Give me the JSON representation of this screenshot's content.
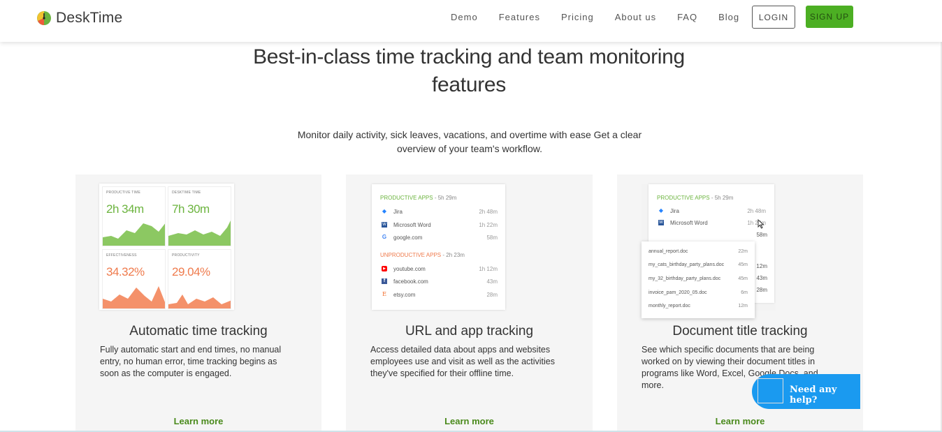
{
  "header": {
    "logo_text": "DeskTime",
    "nav": [
      "Demo",
      "Features",
      "Pricing",
      "About us",
      "FAQ",
      "Blog"
    ],
    "login_label": "LOGIN",
    "signup_label": "SIGN UP",
    "colors": {
      "signup_bg": "#4caf23"
    }
  },
  "hero": {
    "title_line1": "Best-in-class time tracking and team monitoring",
    "title_line2": "features",
    "subtitle_line1": "Monitor daily activity, sick leaves, vacations, and overtime with ease Get a clear",
    "subtitle_line2": "overview of your team's workflow."
  },
  "cards": [
    {
      "title": "Automatic time tracking",
      "desc_lines": [
        "Fully automatic start and end times, no manual",
        "entry, no human error, time tracking begins as",
        "soon as the computer is engaged."
      ],
      "link": "Learn more",
      "tiles": [
        {
          "label": "PRODUCTIVE TIME",
          "value": "2h 34m"
        },
        {
          "label": "DESKTIME TIME",
          "value": "7h 30m"
        },
        {
          "label": "EFFECTIVENESS",
          "value": "34.32%"
        },
        {
          "label": "PRODUCTIVITY",
          "value": "29.04%"
        }
      ]
    },
    {
      "title": "URL and app tracking",
      "desc_lines": [
        "Access detailed data about apps and websites",
        "employees use and visit as well as the activities",
        "they've specified for their offline time."
      ],
      "link": "Learn more",
      "productive": {
        "label": "PRODUCTIVE APPS",
        "duration": "- 5h 29m",
        "apps": [
          {
            "name": "Jira",
            "time": "2h 48m"
          },
          {
            "name": "Microsoft Word",
            "time": "1h 22m"
          },
          {
            "name": "google.com",
            "time": "58m"
          }
        ]
      },
      "unproductive": {
        "label": "UNPRODUCTIVE APPS",
        "duration": "- 2h 23m",
        "apps": [
          {
            "name": "youtube.com",
            "time": "1h 12m"
          },
          {
            "name": "facebook.com",
            "time": "43m"
          },
          {
            "name": "etsy.com",
            "time": "28m"
          }
        ]
      }
    },
    {
      "title": "Document title tracking",
      "desc_lines": [
        "See which specific documents that are being",
        "worked on by viewing their document titles in",
        "programs like Word, Excel, Google Docs, and",
        "more."
      ],
      "link": "Learn more",
      "productive": {
        "label": "PRODUCTIVE APPS",
        "duration": "- 5h 29m",
        "apps": [
          {
            "name": "Jira",
            "time": "2h 48m"
          },
          {
            "name": "Microsoft Word",
            "time": "1h 22m"
          }
        ],
        "hidden_times": [
          "58m",
          "1h 12m",
          "43m",
          "28m"
        ]
      },
      "docs": [
        {
          "name": "annual_report.doc",
          "time": "22m"
        },
        {
          "name": "my_cats_birthday_party_plans.doc",
          "time": "45m"
        },
        {
          "name": "my_32_birthday_party_plans.doc",
          "time": "45m"
        },
        {
          "name": "invoice_pam_2020_05.doc",
          "time": "6m"
        },
        {
          "name": "monthly_report.doc",
          "time": "12m"
        }
      ]
    }
  ],
  "chat": {
    "label": "Need any help?"
  }
}
